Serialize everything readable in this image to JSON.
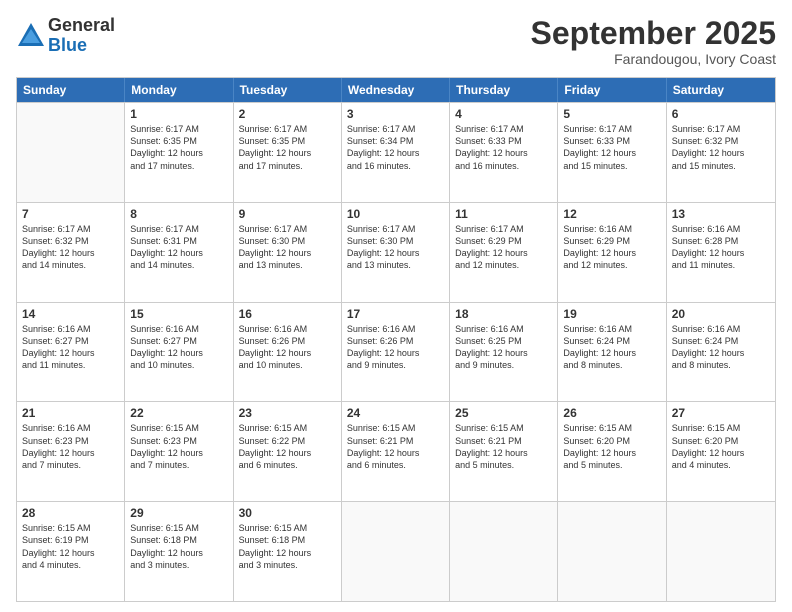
{
  "header": {
    "logo_general": "General",
    "logo_blue": "Blue",
    "month_title": "September 2025",
    "location": "Farandougou, Ivory Coast"
  },
  "days_of_week": [
    "Sunday",
    "Monday",
    "Tuesday",
    "Wednesday",
    "Thursday",
    "Friday",
    "Saturday"
  ],
  "weeks": [
    [
      {
        "day": "",
        "empty": true
      },
      {
        "day": "1",
        "sunrise": "6:17 AM",
        "sunset": "6:35 PM",
        "daylight": "12 hours and 17 minutes."
      },
      {
        "day": "2",
        "sunrise": "6:17 AM",
        "sunset": "6:35 PM",
        "daylight": "12 hours and 17 minutes."
      },
      {
        "day": "3",
        "sunrise": "6:17 AM",
        "sunset": "6:34 PM",
        "daylight": "12 hours and 16 minutes."
      },
      {
        "day": "4",
        "sunrise": "6:17 AM",
        "sunset": "6:33 PM",
        "daylight": "12 hours and 16 minutes."
      },
      {
        "day": "5",
        "sunrise": "6:17 AM",
        "sunset": "6:33 PM",
        "daylight": "12 hours and 15 minutes."
      },
      {
        "day": "6",
        "sunrise": "6:17 AM",
        "sunset": "6:32 PM",
        "daylight": "12 hours and 15 minutes."
      }
    ],
    [
      {
        "day": "7",
        "sunrise": "6:17 AM",
        "sunset": "6:32 PM",
        "daylight": "12 hours and 14 minutes."
      },
      {
        "day": "8",
        "sunrise": "6:17 AM",
        "sunset": "6:31 PM",
        "daylight": "12 hours and 14 minutes."
      },
      {
        "day": "9",
        "sunrise": "6:17 AM",
        "sunset": "6:30 PM",
        "daylight": "12 hours and 13 minutes."
      },
      {
        "day": "10",
        "sunrise": "6:17 AM",
        "sunset": "6:30 PM",
        "daylight": "12 hours and 13 minutes."
      },
      {
        "day": "11",
        "sunrise": "6:17 AM",
        "sunset": "6:29 PM",
        "daylight": "12 hours and 12 minutes."
      },
      {
        "day": "12",
        "sunrise": "6:16 AM",
        "sunset": "6:29 PM",
        "daylight": "12 hours and 12 minutes."
      },
      {
        "day": "13",
        "sunrise": "6:16 AM",
        "sunset": "6:28 PM",
        "daylight": "12 hours and 11 minutes."
      }
    ],
    [
      {
        "day": "14",
        "sunrise": "6:16 AM",
        "sunset": "6:27 PM",
        "daylight": "12 hours and 11 minutes."
      },
      {
        "day": "15",
        "sunrise": "6:16 AM",
        "sunset": "6:27 PM",
        "daylight": "12 hours and 10 minutes."
      },
      {
        "day": "16",
        "sunrise": "6:16 AM",
        "sunset": "6:26 PM",
        "daylight": "12 hours and 10 minutes."
      },
      {
        "day": "17",
        "sunrise": "6:16 AM",
        "sunset": "6:26 PM",
        "daylight": "12 hours and 9 minutes."
      },
      {
        "day": "18",
        "sunrise": "6:16 AM",
        "sunset": "6:25 PM",
        "daylight": "12 hours and 9 minutes."
      },
      {
        "day": "19",
        "sunrise": "6:16 AM",
        "sunset": "6:24 PM",
        "daylight": "12 hours and 8 minutes."
      },
      {
        "day": "20",
        "sunrise": "6:16 AM",
        "sunset": "6:24 PM",
        "daylight": "12 hours and 8 minutes."
      }
    ],
    [
      {
        "day": "21",
        "sunrise": "6:16 AM",
        "sunset": "6:23 PM",
        "daylight": "12 hours and 7 minutes."
      },
      {
        "day": "22",
        "sunrise": "6:15 AM",
        "sunset": "6:23 PM",
        "daylight": "12 hours and 7 minutes."
      },
      {
        "day": "23",
        "sunrise": "6:15 AM",
        "sunset": "6:22 PM",
        "daylight": "12 hours and 6 minutes."
      },
      {
        "day": "24",
        "sunrise": "6:15 AM",
        "sunset": "6:21 PM",
        "daylight": "12 hours and 6 minutes."
      },
      {
        "day": "25",
        "sunrise": "6:15 AM",
        "sunset": "6:21 PM",
        "daylight": "12 hours and 5 minutes."
      },
      {
        "day": "26",
        "sunrise": "6:15 AM",
        "sunset": "6:20 PM",
        "daylight": "12 hours and 5 minutes."
      },
      {
        "day": "27",
        "sunrise": "6:15 AM",
        "sunset": "6:20 PM",
        "daylight": "12 hours and 4 minutes."
      }
    ],
    [
      {
        "day": "28",
        "sunrise": "6:15 AM",
        "sunset": "6:19 PM",
        "daylight": "12 hours and 4 minutes."
      },
      {
        "day": "29",
        "sunrise": "6:15 AM",
        "sunset": "6:18 PM",
        "daylight": "12 hours and 3 minutes."
      },
      {
        "day": "30",
        "sunrise": "6:15 AM",
        "sunset": "6:18 PM",
        "daylight": "12 hours and 3 minutes."
      },
      {
        "day": "",
        "empty": true
      },
      {
        "day": "",
        "empty": true
      },
      {
        "day": "",
        "empty": true
      },
      {
        "day": "",
        "empty": true
      }
    ]
  ]
}
